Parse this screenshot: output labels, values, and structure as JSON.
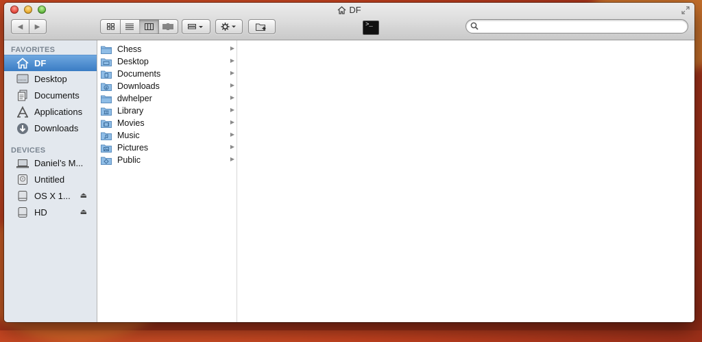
{
  "window": {
    "title": "DF"
  },
  "toolbar": {
    "back_label": "◀",
    "forward_label": "▶",
    "search": {
      "placeholder": "",
      "value": ""
    }
  },
  "sidebar": {
    "favorites_header": "FAVORITES",
    "favorites": [
      {
        "label": "DF",
        "icon": "home-icon",
        "selected": true
      },
      {
        "label": "Desktop",
        "icon": "desktop-icon"
      },
      {
        "label": "Documents",
        "icon": "documents-icon"
      },
      {
        "label": "Applications",
        "icon": "applications-icon"
      },
      {
        "label": "Downloads",
        "icon": "downloads-icon"
      }
    ],
    "devices_header": "DEVICES",
    "devices": [
      {
        "label": "Daniel’s M...",
        "icon": "laptop-icon"
      },
      {
        "label": "Untitled",
        "icon": "disk-icon"
      },
      {
        "label": "OS X 1...",
        "icon": "drive-icon",
        "eject": "⏏"
      },
      {
        "label": "HD",
        "icon": "drive-icon",
        "eject": "⏏"
      }
    ]
  },
  "column": {
    "items": [
      {
        "label": "Chess"
      },
      {
        "label": "Desktop"
      },
      {
        "label": "Documents"
      },
      {
        "label": "Downloads"
      },
      {
        "label": "dwhelper"
      },
      {
        "label": "Library"
      },
      {
        "label": "Movies"
      },
      {
        "label": "Music"
      },
      {
        "label": "Pictures"
      },
      {
        "label": "Public"
      }
    ],
    "arrow": "▶"
  },
  "colors": {
    "selection": "#3a7cc4",
    "sidebar_bg": "#e3e8ee",
    "folder": "#7fb2e0"
  }
}
